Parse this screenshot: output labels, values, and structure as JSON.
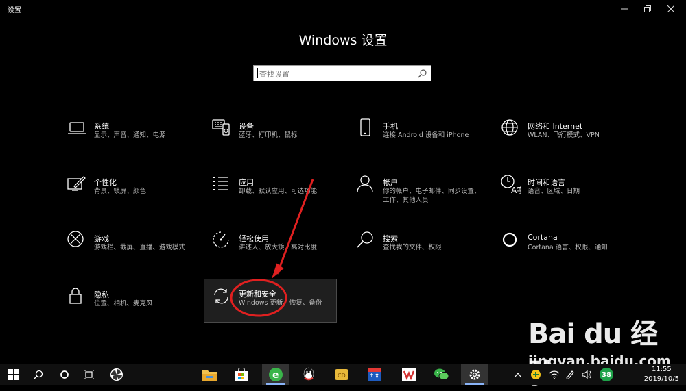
{
  "window": {
    "title": "设置"
  },
  "header": {
    "title": "Windows 设置"
  },
  "search": {
    "placeholder": "查找设置"
  },
  "tiles": [
    {
      "name": "系统",
      "desc": "显示、声音、通知、电源",
      "icon": "laptop-icon"
    },
    {
      "name": "设备",
      "desc": "蓝牙、打印机、鼠标",
      "icon": "devices-icon"
    },
    {
      "name": "手机",
      "desc": "连接 Android 设备和 iPhone",
      "icon": "phone-icon"
    },
    {
      "name": "网络和 Internet",
      "desc": "WLAN、飞行模式、VPN",
      "icon": "globe-icon"
    },
    {
      "name": "个性化",
      "desc": "背景、锁屏、颜色",
      "icon": "personalization-icon"
    },
    {
      "name": "应用",
      "desc": "卸载、默认应用、可选功能",
      "icon": "apps-list-icon"
    },
    {
      "name": "帐户",
      "desc": "你的帐户、电子邮件、同步设置、工作、其他人员",
      "icon": "person-icon"
    },
    {
      "name": "时间和语言",
      "desc": "语音、区域、日期",
      "icon": "time-language-icon"
    },
    {
      "name": "游戏",
      "desc": "游戏栏、截屏、直播、游戏模式",
      "icon": "xbox-icon"
    },
    {
      "name": "轻松使用",
      "desc": "讲述人、放大镜、高对比度",
      "icon": "ease-of-access-icon"
    },
    {
      "name": "搜索",
      "desc": "查找我的文件、权限",
      "icon": "search-icon"
    },
    {
      "name": "Cortana",
      "desc": "Cortana 语言、权限、通知",
      "icon": "cortana-icon"
    },
    {
      "name": "隐私",
      "desc": "位置、相机、麦克风",
      "icon": "lock-icon"
    },
    {
      "name": "更新和安全",
      "desc": "Windows 更新、恢复、备份",
      "icon": "sync-icon",
      "selected": true
    }
  ],
  "watermark": {
    "logo": "Bai du 经验",
    "url": "jingyan.baidu.com"
  },
  "taskbar": {
    "apps": [
      "start-icon",
      "search-icon",
      "cortana-icon",
      "task-view-icon",
      "pinwheel-icon",
      "file-explorer-icon",
      "store-icon",
      "ie-browser-icon",
      "qq-icon",
      "app-folder-icon",
      "app-store-icon",
      "wps-icon",
      "wechat-icon",
      "settings-gear-icon"
    ],
    "badge": "38",
    "time": "11:55",
    "date": "2019/10/5"
  },
  "colors": {
    "background": "#000000",
    "annotation": "#e02020",
    "taskbar": "#101010"
  }
}
